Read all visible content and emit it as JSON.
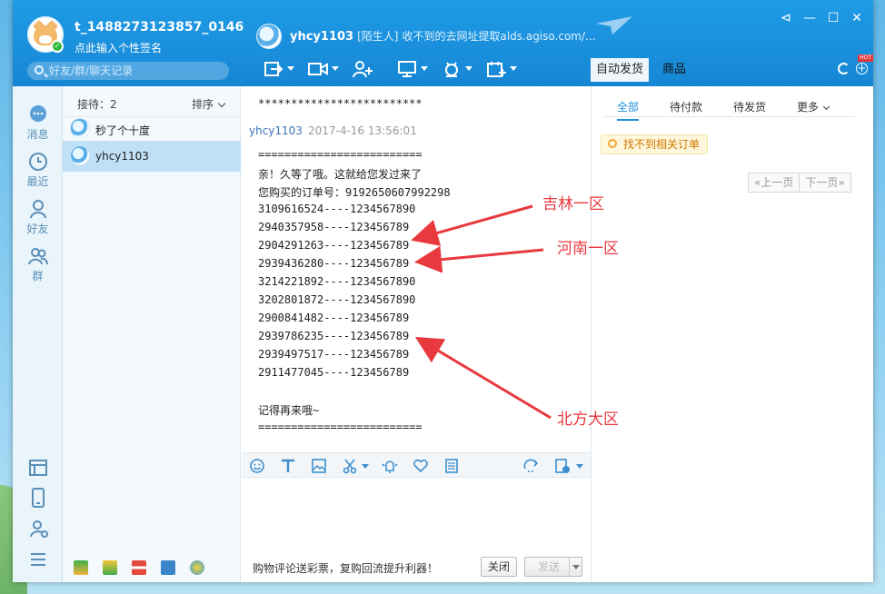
{
  "account": {
    "name": "t_1488273123857_0146",
    "signature": "点此输入个性签名",
    "search_placeholder": "好友/群/聊天记录"
  },
  "chat_header": {
    "contact_name": "yhcy1103",
    "tag": "[陌生人]",
    "note": "收不到的去网址提取alds.agiso.com/..."
  },
  "right_header": {
    "tab_auto_ship": "自动发货",
    "tab_goods": "商品",
    "hot_badge": "HOT"
  },
  "sidebar": {
    "items": [
      {
        "label": "消息",
        "icon": "message-icon"
      },
      {
        "label": "最近",
        "icon": "clock-icon"
      },
      {
        "label": "好友",
        "icon": "friend-icon"
      },
      {
        "label": "群",
        "icon": "group-icon"
      }
    ]
  },
  "contacts": {
    "reception_label": "接待：2",
    "sort_label": "排序",
    "items": [
      {
        "name": "秒了个十度"
      },
      {
        "name": "yhcy1103"
      }
    ]
  },
  "chat": {
    "top_line": "*************************",
    "sender": "yhcy1103",
    "time": "2017-4-16 13:56:01",
    "lines": [
      "=========================",
      "亲！久等了哦。这就给您发过来了",
      "您购买的订单号：9192650607992298",
      "3109616524----1234567890",
      "2940357958----123456789",
      "2904291263----123456789",
      "2939436280----123456789",
      "3214221892----1234567890",
      "3202801872----1234567890",
      "2900841482----123456789",
      "2939786235----123456789",
      "2939497517----123456789",
      "2911477045----123456789",
      "",
      "记得再来哦~",
      "========================="
    ],
    "promo": "购物评论送彩票，复购回流提升利器！",
    "close_label": "关闭",
    "send_label": "发送"
  },
  "orders": {
    "tabs": [
      "全部",
      "待付款",
      "待发货",
      "更多"
    ],
    "notice": "找不到相关订单",
    "prev_label": "«上一页",
    "next_label": "下一页»"
  },
  "annotations": [
    "吉林一区",
    "河南一区",
    "北方大区"
  ],
  "colors": {
    "header_blue": "#1a8fdc",
    "annotation_red": "#e8393e"
  }
}
